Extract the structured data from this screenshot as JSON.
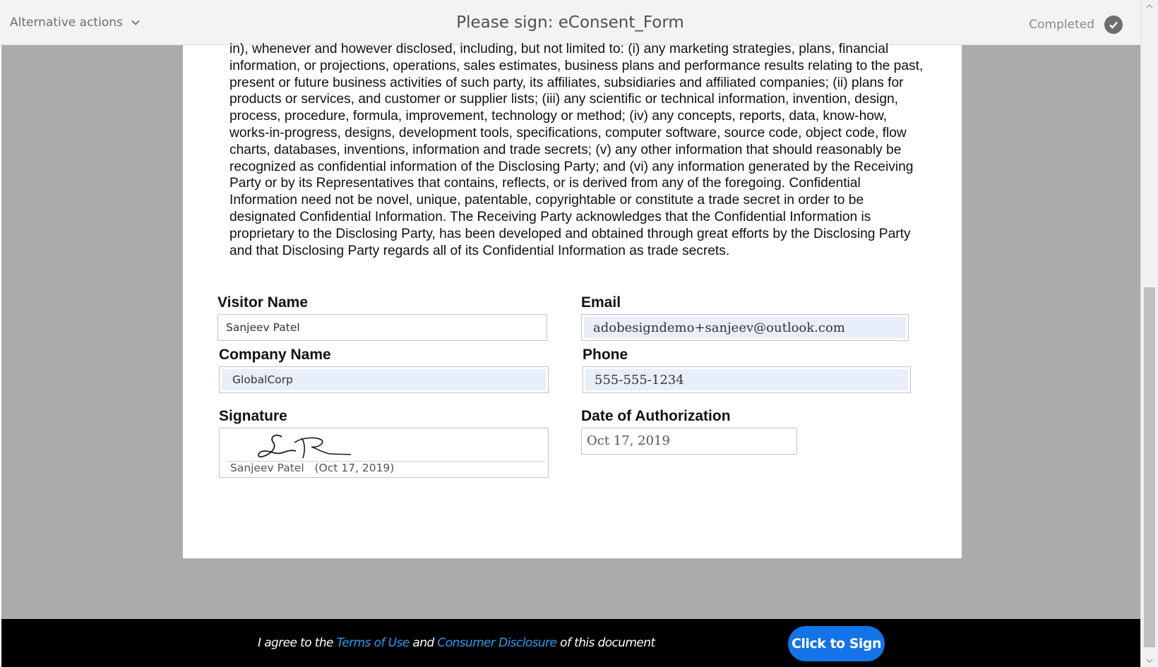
{
  "header": {
    "alternative_actions_label": "Alternative actions",
    "title": "Please sign: eConsent_Form",
    "status_label": "Completed"
  },
  "document": {
    "paragraph": "in), whenever and however disclosed, including, but not limited to: (i) any marketing strategies, plans, financial information, or projections, operations, sales estimates, business plans and performance results relating to the past, present or future business activities of such party, its affiliates, subsidiaries and affiliated companies; (ii) plans for products or services, and customer or supplier lists; (iii) any scientific or technical information, invention, design, process, procedure, formula, improvement, technology or method; (iv) any concepts, reports, data, know-how, works-in-progress, designs, development tools, specifications, computer software, source code, object code, flow charts, databases, inventions, information and trade secrets; (v) any other information that should reasonably be recognized as confidential information of the Disclosing Party; and (vi) any information generated by the Receiving Party or by its Representatives that contains, reflects, or is derived from any of the foregoing.  Confidential Information need not be novel, unique, patentable, copyrightable or constitute a trade secret in order to be designated Confidential Information.  The Receiving Party acknowledges that the Confidential Information is proprietary to the Disclosing Party, has been developed and obtained through great efforts by the Disclosing Party and that Disclosing Party regards all of its Confidential Information as trade secrets.",
    "fields": {
      "visitor_name": {
        "label": "Visitor Name",
        "value": "Sanjeev Patel"
      },
      "email": {
        "label": "Email",
        "value": "adobesigndemo+sanjeev@outlook.com"
      },
      "company_name": {
        "label": "Company Name",
        "value": "GlobalCorp"
      },
      "phone": {
        "label": "Phone",
        "value": "555-555-1234"
      },
      "signature": {
        "label": "Signature",
        "signer_name": "Sanjeev Patel",
        "signed_date": "(Oct 17, 2019)"
      },
      "date_of_authorization": {
        "label": "Date of Authorization",
        "value": "Oct 17, 2019"
      }
    }
  },
  "footer": {
    "agree_prefix": "I agree to the ",
    "terms_link": "Terms of Use",
    "and_text": " and ",
    "disclosure_link": "Consumer Disclosure",
    "agree_suffix": " of this document",
    "sign_button": "Click to Sign"
  },
  "colors": {
    "accent_button": "#1473e6",
    "link": "#2d9bf0",
    "field_highlight": "#e8eefa",
    "viewer_background": "#ababab"
  },
  "icons": [
    "chevron-down-icon",
    "checkmark-circle-icon",
    "handwritten-signature",
    "scroll-up-arrow-icon",
    "scroll-down-arrow-icon"
  ]
}
